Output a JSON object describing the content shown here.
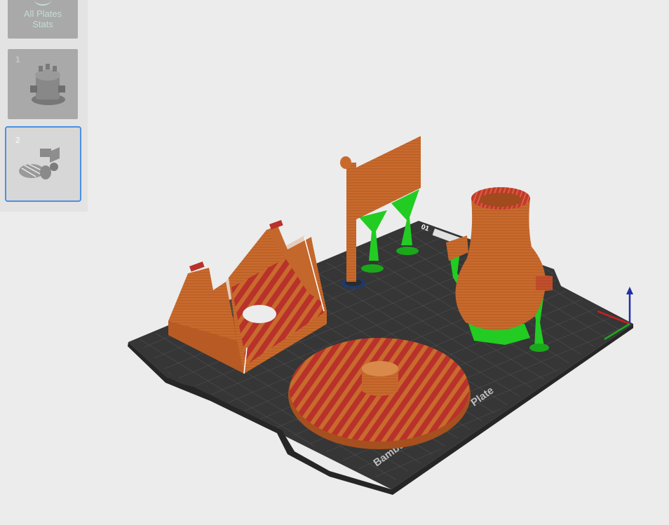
{
  "sidebar": {
    "stats_card": {
      "line1": "All Plates",
      "line2": "Stats"
    },
    "plates": [
      {
        "number": "1",
        "selected": false
      },
      {
        "number": "2",
        "selected": true
      }
    ]
  },
  "viewport": {
    "bed_label": "Bambu",
    "bed_label_2": "Plate",
    "bed_corner_label": "01"
  },
  "colors": {
    "background": "#ececec",
    "bed": "#3c3c3c",
    "model_orange": "#c96a2d",
    "top_surface_red": "#c0392b",
    "support_green": "#22cc22",
    "selection_blue": "#4a90e2",
    "axis_z": "#1f2fa8",
    "axis_x": "#cc1f1f",
    "axis_y": "#1fa81f"
  }
}
